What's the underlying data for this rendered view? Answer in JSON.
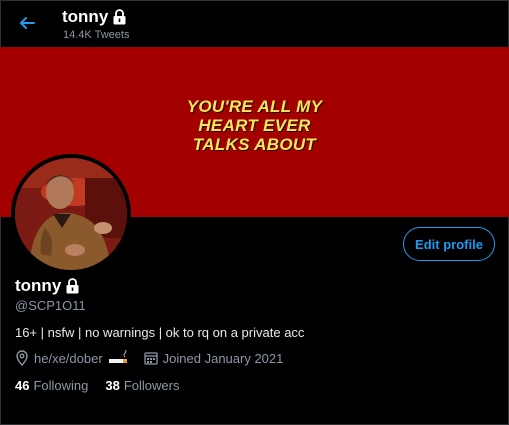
{
  "header": {
    "name": "tonny",
    "tweet_count": "14.4K Tweets"
  },
  "banner": {
    "lines": [
      "YOU'RE ALL MY",
      "HEART EVER",
      "TALKS ABOUT"
    ]
  },
  "profile": {
    "name": "tonny",
    "handle": "@SCP1O11",
    "bio": "16+ | nsfw | no warnings | ok to rq on a private acc",
    "location": "he/xe/dober",
    "joined": "Joined January 2021",
    "edit_label": "Edit profile"
  },
  "stats": {
    "following_count": "46",
    "following_label": "Following",
    "followers_count": "38",
    "followers_label": "Followers"
  },
  "colors": {
    "accent": "#1d9bf0",
    "banner_bg": "#a30000",
    "banner_text": "#f5e85a",
    "secondary_text": "#8b98a5"
  }
}
